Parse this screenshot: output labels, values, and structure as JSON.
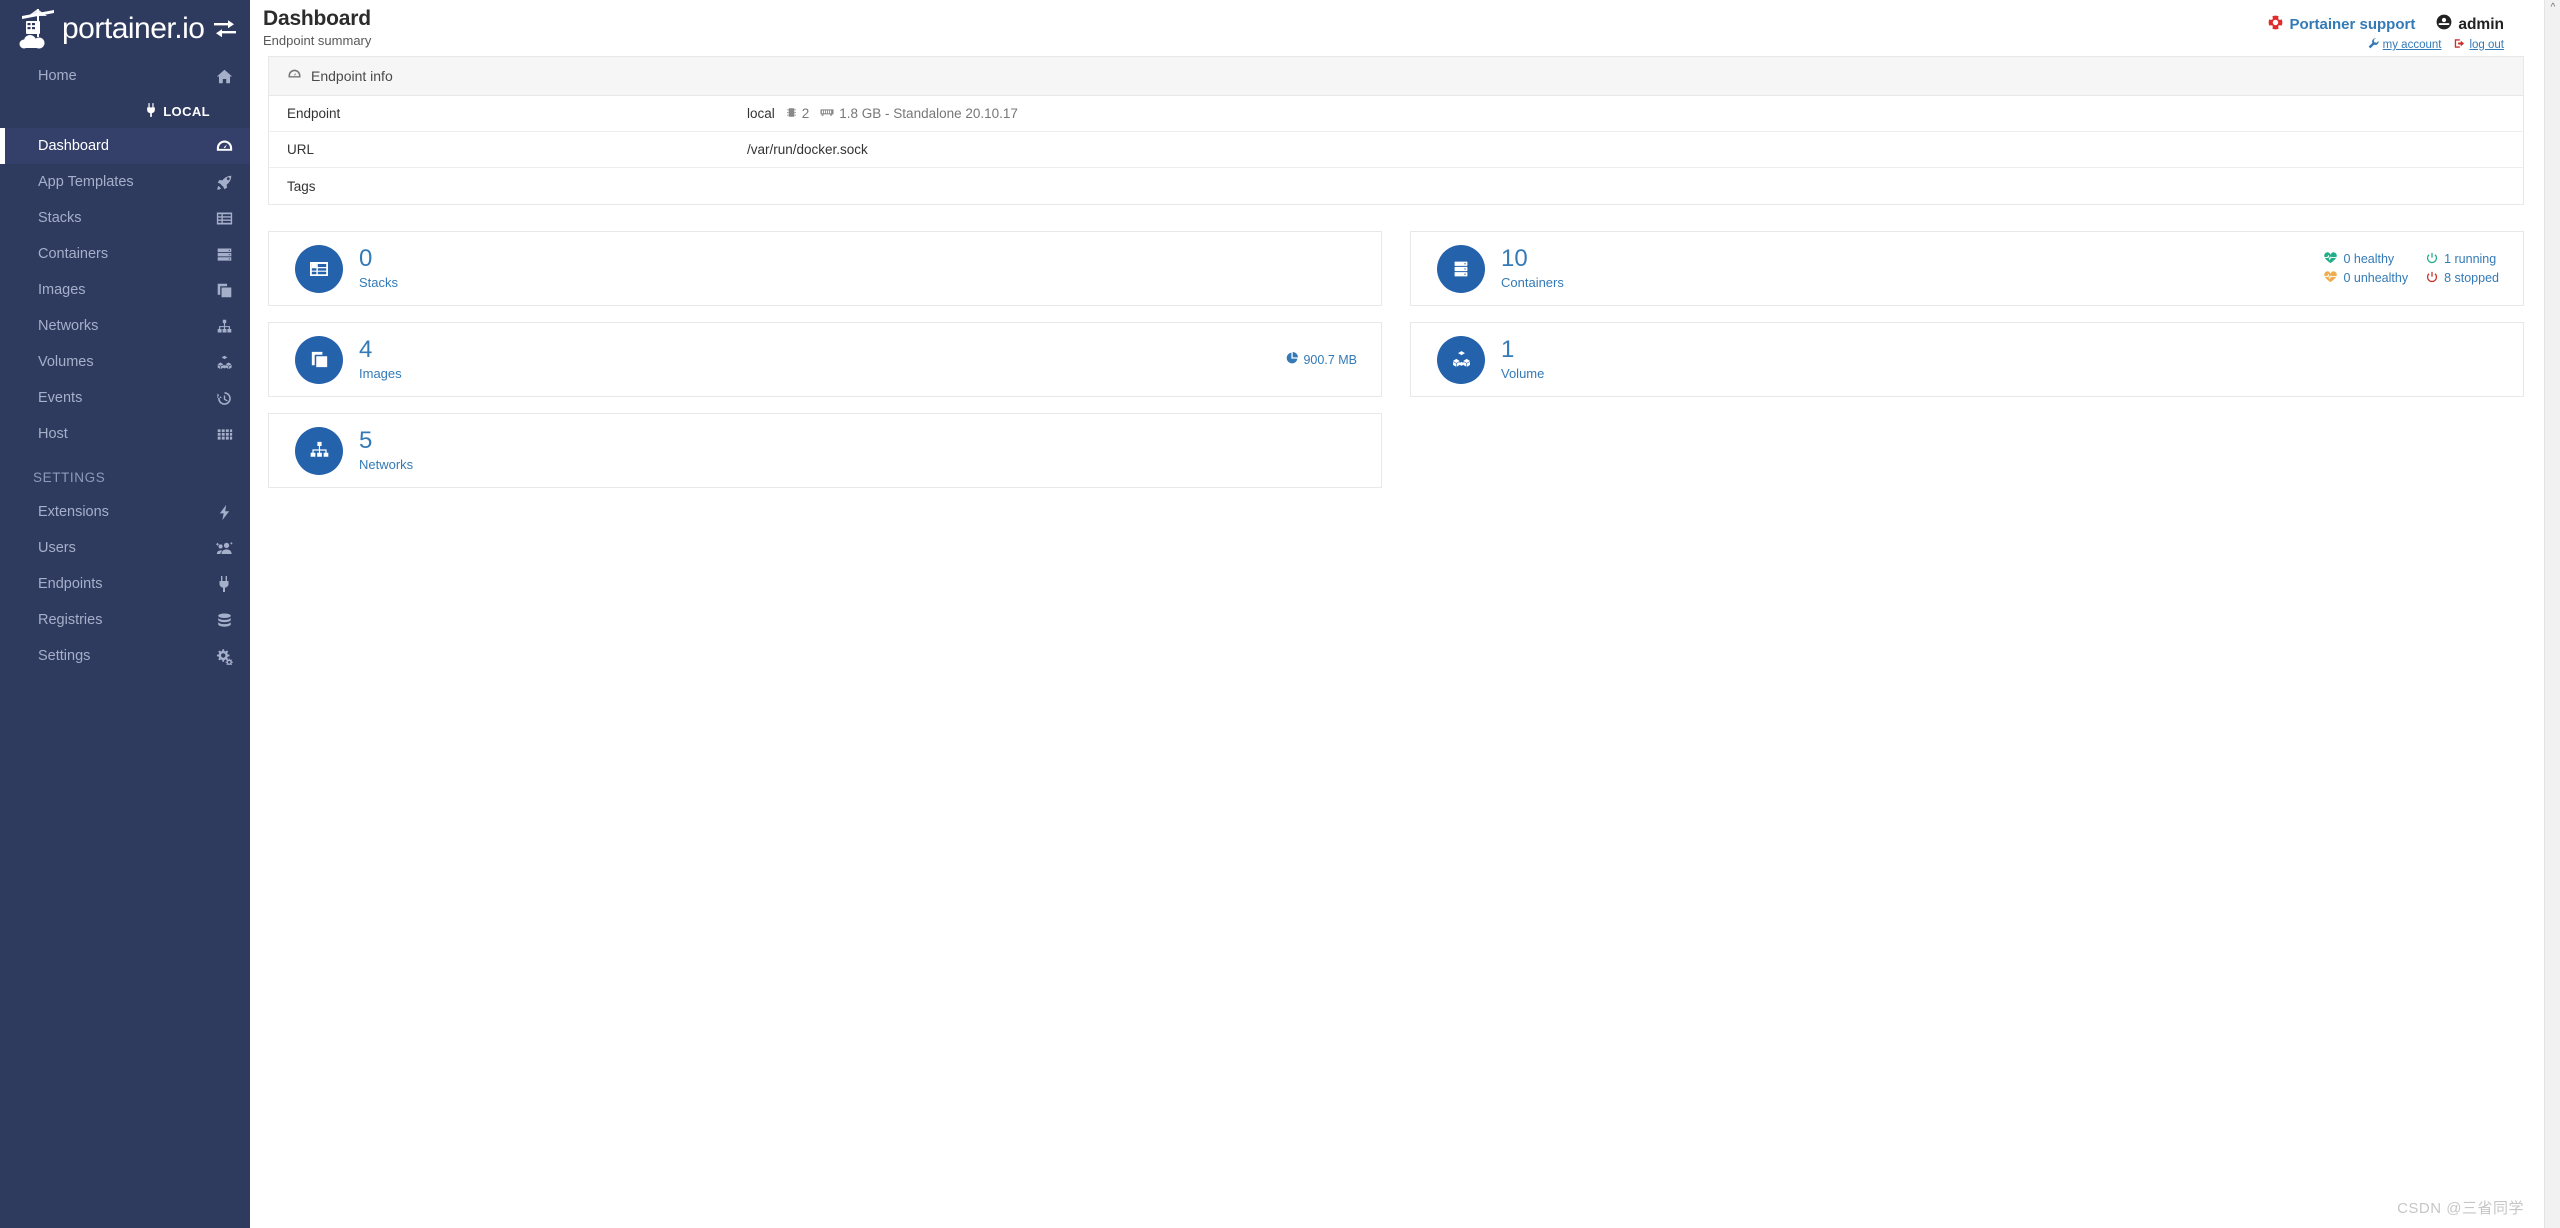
{
  "brand": {
    "name": "portainer.io",
    "logo_icon": "portainer-crane-logo",
    "switch_icon": "endpoint-switch-icon"
  },
  "sidebar": {
    "home": {
      "label": "Home",
      "icon": "home-icon"
    },
    "local_section": {
      "label": "LOCAL",
      "icon": "plug-icon"
    },
    "items": [
      {
        "label": "Dashboard",
        "icon": "dashboard-gauge-icon",
        "active": true
      },
      {
        "label": "App Templates",
        "icon": "rocket-icon",
        "active": false
      },
      {
        "label": "Stacks",
        "icon": "table-icon",
        "active": false
      },
      {
        "label": "Containers",
        "icon": "server-icon",
        "active": false
      },
      {
        "label": "Images",
        "icon": "clone-icon",
        "active": false
      },
      {
        "label": "Networks",
        "icon": "sitemap-icon",
        "active": false
      },
      {
        "label": "Volumes",
        "icon": "cubes-icon",
        "active": false
      },
      {
        "label": "Events",
        "icon": "history-icon",
        "active": false
      },
      {
        "label": "Host",
        "icon": "th-large-icon",
        "active": false
      }
    ],
    "settings_section": {
      "label": "SETTINGS"
    },
    "settings_items": [
      {
        "label": "Extensions",
        "icon": "bolt-icon"
      },
      {
        "label": "Users",
        "icon": "users-icon"
      },
      {
        "label": "Endpoints",
        "icon": "plug-icon"
      },
      {
        "label": "Registries",
        "icon": "database-icon"
      },
      {
        "label": "Settings",
        "icon": "cogs-icon"
      }
    ]
  },
  "header": {
    "title": "Dashboard",
    "subtitle": "Endpoint summary",
    "support_label": "Portainer support",
    "support_icon": "life-ring-icon",
    "user_name": "admin",
    "user_icon": "user-circle-icon",
    "my_account_label": "my account",
    "my_account_icon": "wrench-icon",
    "logout_label": "log out",
    "logout_icon": "sign-out-icon"
  },
  "endpoint_info": {
    "panel_title": "Endpoint info",
    "panel_icon": "tachometer-icon",
    "rows": [
      {
        "key": "Endpoint",
        "value": "local",
        "cpu_icon": "memory-icon",
        "cpu": "2",
        "ram_icon": "ram-icon",
        "ram": "1.8 GB - Standalone 20.10.17"
      },
      {
        "key": "URL",
        "value": "/var/run/docker.sock"
      },
      {
        "key": "Tags",
        "value": ""
      }
    ]
  },
  "cards": {
    "left": [
      {
        "value": "0",
        "label": "Stacks",
        "icon": "stacks-table-icon"
      },
      {
        "value": "4",
        "label": "Images",
        "icon": "images-clone-icon",
        "extra": "900.7 MB",
        "extra_icon": "pie-chart-icon"
      },
      {
        "value": "5",
        "label": "Networks",
        "icon": "networks-sitemap-icon"
      }
    ],
    "right": [
      {
        "value": "10",
        "label": "Containers",
        "icon": "containers-server-icon",
        "badges": [
          {
            "text": "0 healthy",
            "icon": "heartbeat-icon",
            "color": "#23ae89"
          },
          {
            "text": "1 running",
            "icon": "power-icon",
            "color": "#23ae89"
          },
          {
            "text": "0 unhealthy",
            "icon": "heartbeat-icon",
            "color": "#f0ad4e"
          },
          {
            "text": "8 stopped",
            "icon": "power-icon",
            "color": "#c9302c"
          }
        ]
      },
      {
        "value": "1",
        "label": "Volume",
        "icon": "volumes-cubes-icon"
      }
    ]
  },
  "watermark": "CSDN @三省同学",
  "colors": {
    "sidebar_bg": "#2f3a5f",
    "sidebar_active_bg": "#35406a",
    "accent_blue": "#337ab7",
    "icon_circle": "#2462ac",
    "healthy_green": "#23ae89",
    "unhealthy_orange": "#f0ad4e",
    "stopped_red": "#c9302c",
    "support_red": "#e02b2b"
  }
}
